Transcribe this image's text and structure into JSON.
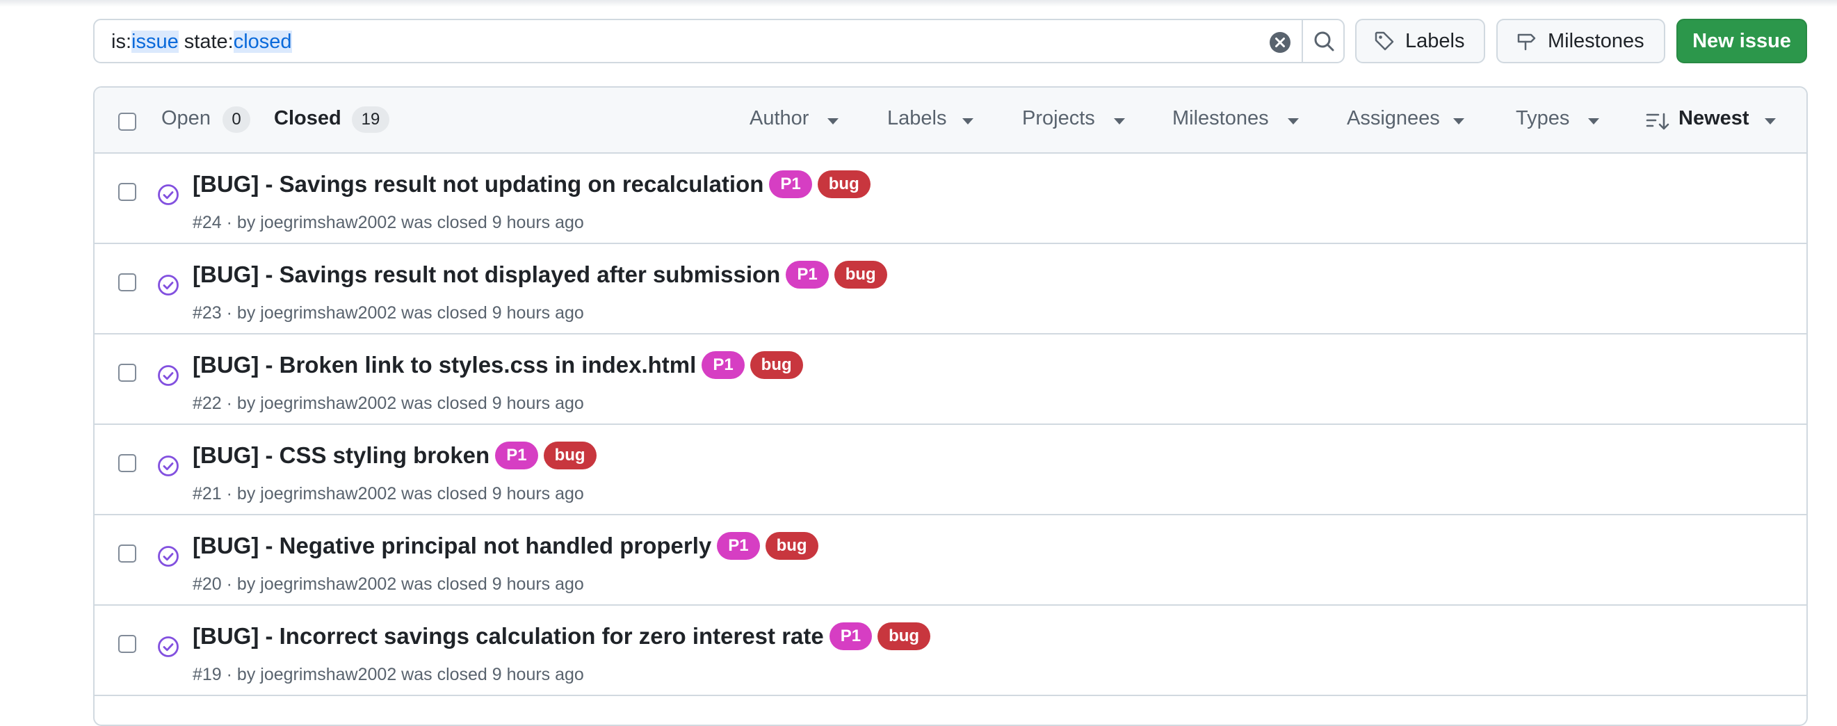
{
  "search": {
    "prefix1": "is:",
    "value1": "issue",
    "prefix2": " state:",
    "value2": "closed"
  },
  "toolbar": {
    "labels_label": "Labels",
    "milestones_label": "Milestones",
    "new_issue_label": "New issue"
  },
  "tabs": {
    "open_label": "Open",
    "open_count": "0",
    "closed_label": "Closed",
    "closed_count": "19"
  },
  "filters": [
    "Author",
    "Labels",
    "Projects",
    "Milestones",
    "Assignees",
    "Types"
  ],
  "sort": {
    "label": "Newest"
  },
  "colors": {
    "accent": "#0969da",
    "closed_icon": "#8250df",
    "label_p1": "#d63ec3",
    "label_bug": "#c8363e",
    "new_issue": "#2c974b"
  },
  "issues": [
    {
      "title": "[BUG] - Savings result not updating on recalculation",
      "meta": "#24 · by joegrimshaw2002 was closed 9 hours ago",
      "label1": "P1",
      "label2": "bug"
    },
    {
      "title": "[BUG] - Savings result not displayed after submission",
      "meta": "#23 · by joegrimshaw2002 was closed 9 hours ago",
      "label1": "P1",
      "label2": "bug"
    },
    {
      "title": "[BUG] - Broken link to styles.css in index.html",
      "meta": "#22 · by joegrimshaw2002 was closed 9 hours ago",
      "label1": "P1",
      "label2": "bug"
    },
    {
      "title": "[BUG] - CSS styling broken",
      "meta": "#21 · by joegrimshaw2002 was closed 9 hours ago",
      "label1": "P1",
      "label2": "bug"
    },
    {
      "title": "[BUG] - Negative principal not handled properly",
      "meta": "#20 · by joegrimshaw2002 was closed 9 hours ago",
      "label1": "P1",
      "label2": "bug"
    },
    {
      "title": "[BUG] - Incorrect savings calculation for zero interest rate",
      "meta": "#19 · by joegrimshaw2002 was closed 9 hours ago",
      "label1": "P1",
      "label2": "bug"
    }
  ]
}
